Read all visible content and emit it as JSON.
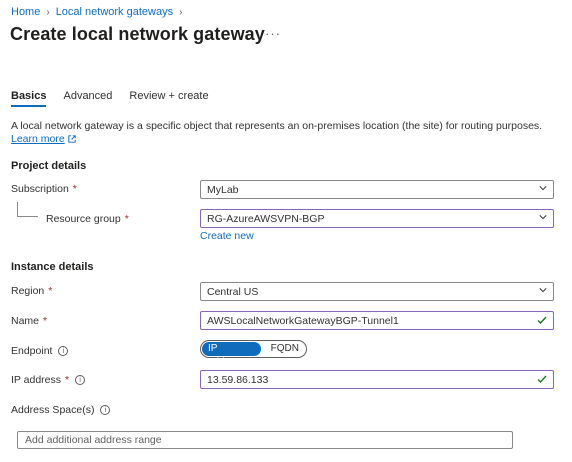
{
  "breadcrumb": {
    "home": "Home",
    "sep1": "›",
    "parent": "Local network gateways",
    "sep2": "›"
  },
  "page": {
    "title": "Create local network gateway",
    "more": "···"
  },
  "tabs": [
    {
      "label": "Basics"
    },
    {
      "label": "Advanced"
    },
    {
      "label": "Review + create"
    }
  ],
  "description": {
    "text": "A local network gateway is a specific object that represents an on-premises location (the site) for routing purposes.",
    "learn_more": "Learn more"
  },
  "project_details": {
    "heading": "Project details",
    "subscription": {
      "label": "Subscription",
      "required": "*",
      "value": "MyLab"
    },
    "resource_group": {
      "label": "Resource group",
      "required": "*",
      "value": "RG-AzureAWSVPN-BGP",
      "create_new": "Create new"
    }
  },
  "instance_details": {
    "heading": "Instance details",
    "region": {
      "label": "Region",
      "required": "*",
      "value": "Central US"
    },
    "name": {
      "label": "Name",
      "required": "*",
      "value": "AWSLocalNetworkGatewayBGP-Tunnel1"
    },
    "endpoint": {
      "label": "Endpoint",
      "info": "i",
      "options": [
        "IP address",
        "FQDN"
      ],
      "selected": "IP address"
    },
    "ip_address": {
      "label": "IP address",
      "required": "*",
      "info": "i",
      "value": "13.59.86.133"
    },
    "address_space": {
      "label": "Address Space(s)",
      "info": "i",
      "placeholder": "Add additional address range"
    }
  },
  "colors": {
    "accent": "#0f6cbd",
    "required": "#a4262c",
    "valid": "#107c10",
    "focus_border": "#8764b8"
  },
  "icons": {
    "dropdown": "chevron-down-icon",
    "valid": "checkmark-icon",
    "info": "info-icon",
    "external": "external-link-icon"
  }
}
